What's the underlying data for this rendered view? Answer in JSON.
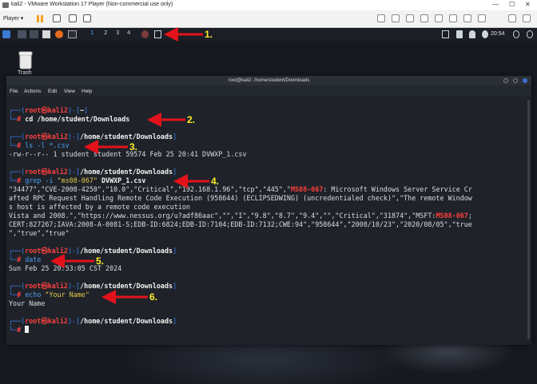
{
  "vmware": {
    "title": "kali2 - VMware Workstation 17 Player (Non-commercial use only)",
    "player_menu": "Player ▾",
    "window_controls": [
      "—",
      "☐",
      "✕"
    ]
  },
  "panel": {
    "workspaces": [
      "1",
      "2",
      "3",
      "4"
    ],
    "clock": "20:54"
  },
  "desktop": {
    "trash_label": "Trash"
  },
  "terminal": {
    "title": "root@kali2: /home/student/Downloads",
    "menu": [
      "File",
      "Actions",
      "Edit",
      "View",
      "Help"
    ],
    "prompt": {
      "open": "┌──(",
      "user": "root",
      "at": "㉿",
      "host": "kali2",
      "sep": ")-[",
      "close": "]",
      "hash_line": "└─",
      "hash": "#"
    },
    "blocks": [
      {
        "path": "~",
        "command": "cd /home/student/Downloads",
        "output": []
      },
      {
        "path": "/home/student/Downloads",
        "command": "ls -l *.csv",
        "output": [
          "-rw-r--r-- 1 student student 59574 Feb 25 20:41 DVWXP_1.csv"
        ]
      },
      {
        "path": "/home/student/Downloads",
        "command_prefix": "grep -i ",
        "command_arg": "\"ms08-067\"",
        "command_suffix": " DVWXP_1.csv"
      },
      {
        "path": "/home/student/Downloads",
        "command": "date",
        "output": [
          "Sun Feb 25 20:53:05 CST 2024"
        ]
      },
      {
        "path": "/home/student/Downloads",
        "command_prefix": "echo ",
        "command_arg": "\"Your Name\"",
        "output": [
          "Your Name"
        ]
      },
      {
        "path": "/home/student/Downloads"
      }
    ],
    "grep_output": {
      "l1a": "\"34477\",\"CVE-2008-4250\",\"10.0\",\"Critical\",\"192.168.1.96\",\"tcp\",\"445\",\"",
      "l1b": "MS08-067",
      "l1c": ": Microsoft Windows Server Service Cr",
      "l2": "afted RPC Request Handling Remote Code Execution (958644) (ECLIPSEDWING) (uncredentialed check)\",\"The remote Window",
      "l3": "s host is affected by a remote code execution",
      "l4a": "Vista and 2008.\",\"https://www.nessus.org/u?adf86aac\",\"\",\"I\",\"9.8\",\"8.7\",\"9.4\",\"\",\"Critical\",\"31874\",\"MSFT:",
      "l4b": "MS08-067",
      "l4c": ";",
      "l5a": "CERT:827267;IAVA:2008-A-0081-S;EDB-ID:6824;EDB-ID:7104;EDB-ID:7132;CWE:94\",\"958644\",\"2008/10/23\",\"2020/08/05\",\"true",
      "l6": "\",\"true\",\"true\""
    }
  },
  "annotations": [
    "1.",
    "2.",
    "3.",
    "4.",
    "5.",
    "6."
  ],
  "colors": {
    "arrow": "#e3121b",
    "annotation": "#ffef2a",
    "prompt_blue": "#3a7ff0",
    "prompt_red": "#ff3f3f"
  }
}
